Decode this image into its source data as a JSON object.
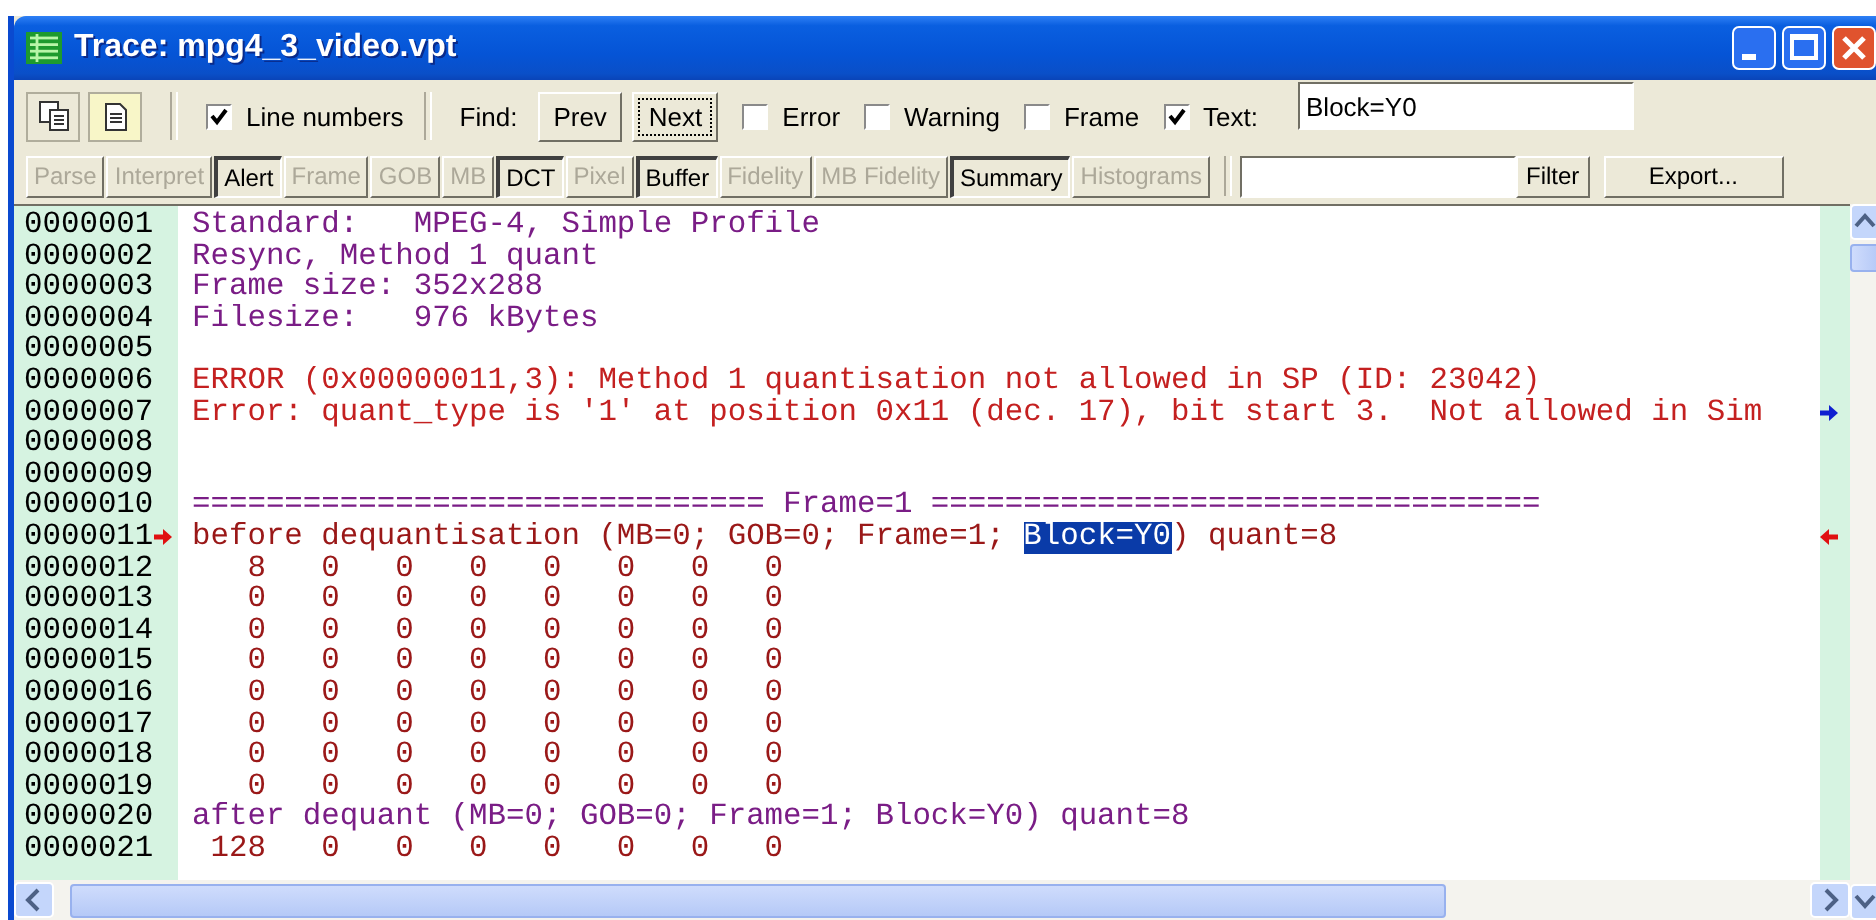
{
  "window": {
    "title": "Trace: mpg4_3_video.vpt"
  },
  "toolbar": {
    "line_numbers": {
      "label": "Line numbers",
      "checked": true
    },
    "find_label": "Find:",
    "buttons": [
      {
        "label": "Prev",
        "focused": false
      },
      {
        "label": "Next",
        "focused": true
      }
    ],
    "filters": [
      {
        "label": "Error",
        "checked": false
      },
      {
        "label": "Warning",
        "checked": false
      },
      {
        "label": "Frame",
        "checked": false
      },
      {
        "label": "Text:",
        "checked": true
      }
    ],
    "search": {
      "value": "Block=Y0"
    }
  },
  "views": [
    {
      "label": "Parse",
      "disabled": true
    },
    {
      "label": "Interpret",
      "disabled": true
    },
    {
      "label": "Alert",
      "disabled": false
    },
    {
      "label": "Frame",
      "disabled": true
    },
    {
      "label": "GOB",
      "disabled": true
    },
    {
      "label": "MB",
      "disabled": true
    },
    {
      "label": "DCT",
      "disabled": false
    },
    {
      "label": "Pixel",
      "disabled": true
    },
    {
      "label": "Buffer",
      "disabled": false
    },
    {
      "label": "Fidelity",
      "disabled": true
    },
    {
      "label": "MB Fidelity",
      "disabled": true
    },
    {
      "label": "Summary",
      "disabled": false
    },
    {
      "label": "Histograms",
      "disabled": true
    }
  ],
  "filter_button": "Filter",
  "export_button": "Export...",
  "trace": {
    "lines": [
      {
        "number": "0000001",
        "kind": "info",
        "text": "Standard:   MPEG-4, Simple Profile",
        "current": false,
        "overflow": false
      },
      {
        "number": "0000002",
        "kind": "info",
        "text": "Resync, Method 1 quant",
        "current": false,
        "overflow": false
      },
      {
        "number": "0000003",
        "kind": "info",
        "text": "Frame size: 352x288",
        "current": false,
        "overflow": false
      },
      {
        "number": "0000004",
        "kind": "info",
        "text": "Filesize:   976 kBytes",
        "current": false,
        "overflow": false
      },
      {
        "number": "0000005",
        "kind": "blank",
        "current": false,
        "overflow": false
      },
      {
        "number": "0000006",
        "kind": "error",
        "text": "ERROR (0x00000011,3): Method 1 quantisation not allowed in SP (ID: 23042)",
        "current": false,
        "overflow": false
      },
      {
        "number": "0000007",
        "kind": "error",
        "text": "Error: quant_type is '1' at position 0x11 (dec. 17), bit start 3.  Not allowed in Sim",
        "current": false,
        "overflow": true
      },
      {
        "number": "0000008",
        "kind": "blank",
        "current": false,
        "overflow": false
      },
      {
        "number": "0000009",
        "kind": "blank",
        "current": false,
        "overflow": false
      },
      {
        "number": "0000010",
        "kind": "info",
        "text": "=============================== Frame=1 =================================",
        "current": false,
        "overflow": false
      },
      {
        "number": "0000011",
        "kind": "data",
        "parts": [
          {
            "text": "before dequantisation (MB=0; GOB=0; Frame=1; ",
            "selected": false
          },
          {
            "text": "Block=Y0",
            "selected": true
          },
          {
            "text": ") quant=8",
            "selected": false
          }
        ],
        "current": true,
        "overflow": false
      },
      {
        "number": "0000012",
        "kind": "data",
        "text": "   8   0   0   0   0   0   0   0",
        "current": false,
        "overflow": false
      },
      {
        "number": "0000013",
        "kind": "data",
        "text": "   0   0   0   0   0   0   0   0",
        "current": false,
        "overflow": false
      },
      {
        "number": "0000014",
        "kind": "data",
        "text": "   0   0   0   0   0   0   0   0",
        "current": false,
        "overflow": false
      },
      {
        "number": "0000015",
        "kind": "data",
        "text": "   0   0   0   0   0   0   0   0",
        "current": false,
        "overflow": false
      },
      {
        "number": "0000016",
        "kind": "data",
        "text": "   0   0   0   0   0   0   0   0",
        "current": false,
        "overflow": false
      },
      {
        "number": "0000017",
        "kind": "data",
        "text": "   0   0   0   0   0   0   0   0",
        "current": false,
        "overflow": false
      },
      {
        "number": "0000018",
        "kind": "data",
        "text": "   0   0   0   0   0   0   0   0",
        "current": false,
        "overflow": false
      },
      {
        "number": "0000019",
        "kind": "data",
        "text": "   0   0   0   0   0   0   0   0",
        "current": false,
        "overflow": false
      },
      {
        "number": "0000020",
        "kind": "info",
        "text": "after dequant (MB=0; GOB=0; Frame=1; Block=Y0) quant=8",
        "current": false,
        "overflow": false
      },
      {
        "number": "0000021",
        "kind": "data",
        "text": " 128   0   0   0   0   0   0   0",
        "current": false,
        "overflow": false
      }
    ]
  }
}
